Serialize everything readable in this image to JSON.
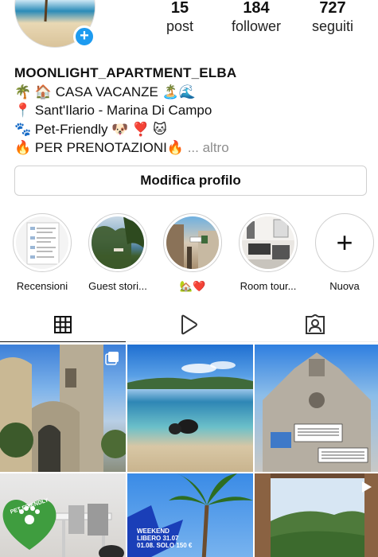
{
  "profile": {
    "username": "MOONLIGHT_APARTMENT_ELBA",
    "bio_lines": [
      "🌴 🏠 CASA VACANZE 🏝️🌊",
      "📍 Sant'Ilario - Marina Di Campo",
      "🐾 Pet-Friendly 🐶 ❣️ 🐱",
      "🔥 PER PRENOTAZIONI🔥"
    ],
    "more_label": " ... altro",
    "avatar_icon": "plus-icon"
  },
  "stats": [
    {
      "value": "15",
      "label": "post"
    },
    {
      "value": "184",
      "label": "follower"
    },
    {
      "value": "727",
      "label": "seguiti"
    }
  ],
  "edit_profile_label": "Modifica profilo",
  "highlights": [
    {
      "label": "Recensioni"
    },
    {
      "label": "Guest stori..."
    },
    {
      "label": "🏡❤️"
    },
    {
      "label": "Room tour..."
    },
    {
      "label": "Nuova"
    }
  ],
  "tabs": [
    {
      "icon": "grid-icon"
    },
    {
      "icon": "reels-icon"
    },
    {
      "icon": "tagged-icon"
    }
  ],
  "grid_posts": [
    {
      "subject": "bell tower",
      "badge": "multi"
    },
    {
      "subject": "beach with dog",
      "badge": ""
    },
    {
      "subject": "church facade",
      "badge": ""
    },
    {
      "subject": "pet friendly dining",
      "badge": "",
      "overlay_text": "PET FRIENDLY"
    },
    {
      "subject": "palm promo",
      "badge": "",
      "overlay_text": "WEEKEND LIBERO 31.07 01.08. SOLO 150 €"
    },
    {
      "subject": "window view",
      "badge": "reel"
    }
  ]
}
